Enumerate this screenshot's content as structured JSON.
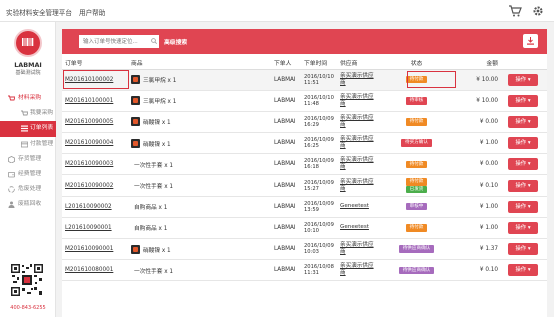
{
  "topbar": {
    "brand": "实验材料安全管理平台",
    "help": "用户帮助",
    "cart_icon": "cart-icon",
    "settings_icon": "gear-icon"
  },
  "sidebar": {
    "logo_name": "LABMAI",
    "logo_sub": "基础测试院",
    "phone": "400-843-6255",
    "items": [
      {
        "label": "材料采购",
        "icon": "cart-icon",
        "level": "top"
      },
      {
        "label": "我要采购",
        "icon": "cart-icon",
        "level": "sub"
      },
      {
        "label": "订单列表",
        "icon": "list-icon",
        "level": "sub",
        "active": true
      },
      {
        "label": "付款管理",
        "icon": "card-icon",
        "level": "sub"
      },
      {
        "label": "存货管理",
        "icon": "box-icon",
        "level": "top"
      },
      {
        "label": "经费管理",
        "icon": "wallet-icon",
        "level": "top"
      },
      {
        "label": "危废处理",
        "icon": "recycle-icon",
        "level": "top"
      },
      {
        "label": "废瓶回收",
        "icon": "person-icon",
        "level": "top"
      }
    ]
  },
  "search": {
    "placeholder": "输入订单号快速定位...",
    "advanced_label": "高级搜索"
  },
  "table": {
    "headers": [
      "订单号",
      "商品",
      "下单人",
      "下单时间",
      "供应商",
      "状态",
      "金额",
      ""
    ],
    "op_label": "操作",
    "rows": [
      {
        "order": "M201610100002",
        "product": "三氯甲烷 x 1",
        "img": true,
        "user": "LABMAI",
        "date": "2016/10/10",
        "time": "11:51",
        "supplier1": "亲买演示供应",
        "supplier2": "商",
        "statuses": [
          {
            "text": "待付款",
            "color": "orange"
          }
        ],
        "amount": "¥ 10.00"
      },
      {
        "order": "M201610100001",
        "product": "三氯甲烷 x 1",
        "img": true,
        "user": "LABMAI",
        "date": "2016/10/10",
        "time": "11:48",
        "supplier1": "亲买演示供应",
        "supplier2": "商",
        "statuses": [
          {
            "text": "待审核",
            "color": "red"
          }
        ],
        "amount": "¥ 10.00"
      },
      {
        "order": "M201610090005",
        "product": "硝酸镍 x 1",
        "img": true,
        "user": "LABMAI",
        "date": "2016/10/09",
        "time": "16:29",
        "supplier1": "亲买演示供应",
        "supplier2": "商",
        "statuses": [
          {
            "text": "待付款",
            "color": "orange"
          }
        ],
        "amount": "¥ 0.00"
      },
      {
        "order": "M201610090004",
        "product": "硝酸镍 x 1",
        "img": true,
        "user": "LABMAI",
        "date": "2016/10/09",
        "time": "16:25",
        "supplier1": "亲买演示供应",
        "supplier2": "商",
        "statuses": [
          {
            "text": "待买方确认",
            "color": "red"
          }
        ],
        "amount": "¥ 1.00"
      },
      {
        "order": "M201610090003",
        "product": "一次性手套 x 1",
        "img": false,
        "user": "LABMAI",
        "date": "2016/10/09",
        "time": "16:18",
        "supplier1": "亲买演示供应",
        "supplier2": "商",
        "statuses": [
          {
            "text": "待付款",
            "color": "orange"
          }
        ],
        "amount": "¥ 0.00"
      },
      {
        "order": "M201610090002",
        "product": "一次性手套 x 1",
        "img": false,
        "user": "LABMAI",
        "date": "2016/10/09",
        "time": "15:27",
        "supplier1": "亲买演示供应",
        "supplier2": "商",
        "statuses": [
          {
            "text": "待付款",
            "color": "orange"
          },
          {
            "text": "已发货",
            "color": "green"
          }
        ],
        "amount": "¥ 0.10"
      },
      {
        "order": "L201610090002",
        "product": "自购商品 x 1",
        "img": false,
        "user": "LABMAI",
        "date": "2016/10/09",
        "time": "13:59",
        "supplier1": "Geneetest",
        "supplier2": "",
        "statuses": [
          {
            "text": "审核中",
            "color": "purple"
          }
        ],
        "amount": "¥ 1.00"
      },
      {
        "order": "L201610090001",
        "product": "自购商品 x 1",
        "img": false,
        "user": "LABMAI",
        "date": "2016/10/09",
        "time": "10:10",
        "supplier1": "Geneetest",
        "supplier2": "",
        "statuses": [
          {
            "text": "待付款",
            "color": "orange"
          }
        ],
        "amount": "¥ 1.00"
      },
      {
        "order": "M201610090001",
        "product": "硝酸镍 x 1",
        "img": true,
        "user": "LABMAI",
        "date": "2016/10/09",
        "time": "10:03",
        "supplier1": "亲买演示供应",
        "supplier2": "商",
        "statuses": [
          {
            "text": "待供应商确认",
            "color": "purple"
          }
        ],
        "amount": "¥ 1.37"
      },
      {
        "order": "M201610080001",
        "product": "一次性手套 x 1",
        "img": false,
        "user": "LABMAI",
        "date": "2016/10/08",
        "time": "11:31",
        "supplier1": "亲买演示供应",
        "supplier2": "商",
        "statuses": [
          {
            "text": "待供应商确认",
            "color": "purple"
          }
        ],
        "amount": "¥ 0.10"
      }
    ]
  },
  "colors": {
    "accent": "#d9323f",
    "search_bar": "#e04552"
  }
}
